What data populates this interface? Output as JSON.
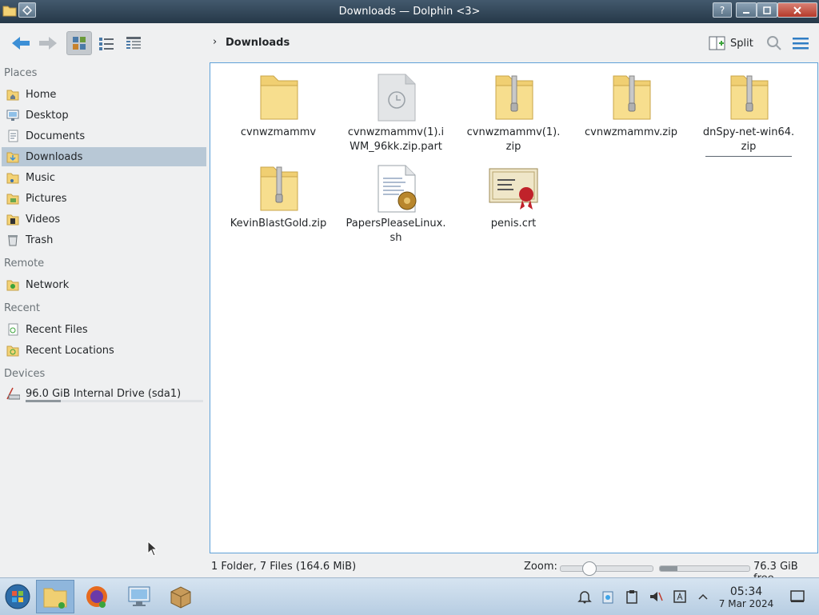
{
  "window": {
    "title": "Downloads — Dolphin <3>"
  },
  "toolbar": {
    "breadcrumb": "Downloads",
    "split_label": "Split"
  },
  "sidebar": {
    "sections": [
      {
        "label": "Places",
        "items": [
          "Home",
          "Desktop",
          "Documents",
          "Downloads",
          "Music",
          "Pictures",
          "Videos",
          "Trash"
        ]
      },
      {
        "label": "Remote",
        "items": [
          "Network"
        ]
      },
      {
        "label": "Recent",
        "items": [
          "Recent Files",
          "Recent Locations"
        ]
      },
      {
        "label": "Devices",
        "items": [
          "96.0 GiB Internal Drive (sda1)"
        ]
      }
    ],
    "selected": "Downloads",
    "drive_usage_fraction": 0.2
  },
  "files": [
    {
      "name": "cvnwzmammv",
      "type": "folder"
    },
    {
      "name": "cvnwzmammv(1).i\nWM_96kk.zip.part",
      "type": "part"
    },
    {
      "name": "cvnwzmammv(1).\nzip",
      "type": "zip"
    },
    {
      "name": "cvnwzmammv.zip",
      "type": "zip"
    },
    {
      "name": "dnSpy-net-win64.\nzip",
      "type": "zip"
    },
    {
      "name": "KevinBlastGold.zip",
      "type": "zip"
    },
    {
      "name": "PapersPleaseLinux.\nsh",
      "type": "script"
    },
    {
      "name": "penis.crt",
      "type": "cert"
    }
  ],
  "status": {
    "summary": "1 Folder, 7 Files (164.6 MiB)",
    "zoom_label": "Zoom:",
    "zoom_fraction": 0.27,
    "free_space": "76.3 GiB free",
    "used_fraction": 0.2
  },
  "taskbar": {
    "time": "05:34",
    "date": "7 Mar 2024"
  },
  "colors": {
    "selection": "#b8c8d6",
    "view_border": "#5fa1d8",
    "folder": "#f3d275"
  }
}
